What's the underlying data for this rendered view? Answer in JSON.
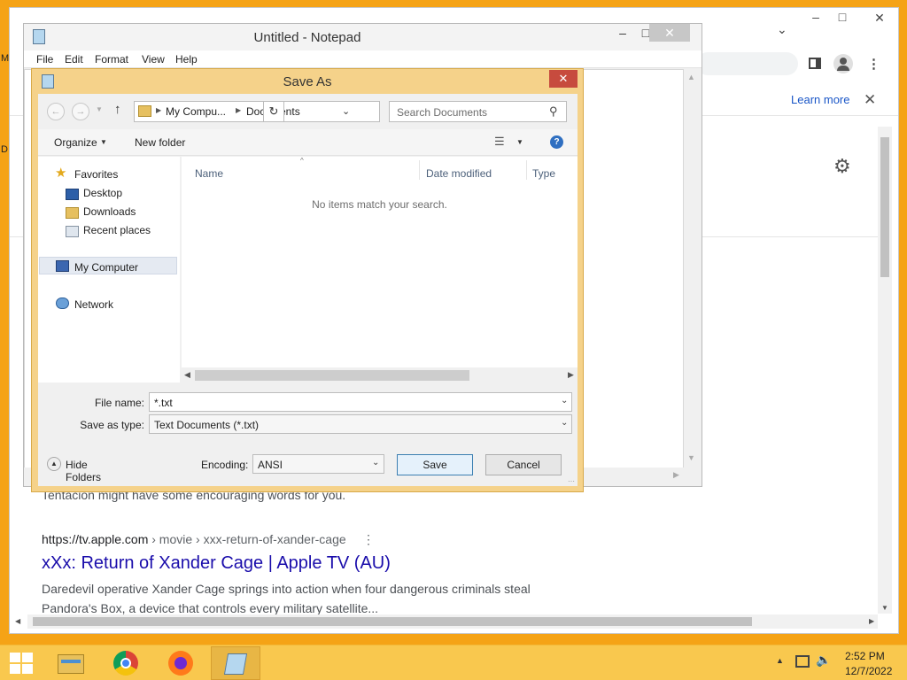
{
  "desktop": {
    "frag_m": "M",
    "frag_d": "D"
  },
  "chrome": {
    "minimize": "–",
    "maximize": "□",
    "close": "✕",
    "tab_dropdown": "⌄",
    "info_bar": {
      "learn_more": "Learn more",
      "close": "✕"
    },
    "results": {
      "fragment": "Tentación might have some encouraging words for you.",
      "url_host": "https://tv.apple.com",
      "url_path": " › movie › xxx-return-of-xander-cage",
      "title": "xXx: Return of Xander Cage | Apple TV (AU)",
      "desc_line1": "Daredevil operative Xander Cage springs into action when four dangerous criminals steal",
      "desc_line2": "Pandora's Box, a device that controls every military satellite..."
    }
  },
  "notepad": {
    "title": "Untitled - Notepad",
    "menu": [
      "File",
      "Edit",
      "Format",
      "View",
      "Help"
    ],
    "min": "–",
    "max": "□",
    "close": "✕"
  },
  "save_as": {
    "title": "Save As",
    "close": "✕",
    "breadcrumb": [
      "My Compu...",
      "Documents"
    ],
    "search_placeholder": "Search Documents",
    "toolbar": {
      "organize": "Organize",
      "new_folder": "New folder"
    },
    "nav": {
      "favorites": "Favorites",
      "desktop": "Desktop",
      "downloads": "Downloads",
      "recent": "Recent places",
      "my_computer": "My Computer",
      "network": "Network"
    },
    "columns": [
      "Name",
      "Date modified",
      "Type"
    ],
    "empty_message": "No items match your search.",
    "file_name_label": "File name:",
    "file_name_value": "*.txt",
    "save_type_label": "Save as type:",
    "save_type_value": "Text Documents (*.txt)",
    "hide_folders": "Hide Folders",
    "encoding_label": "Encoding:",
    "encoding_value": "ANSI",
    "save_button": "Save",
    "cancel_button": "Cancel"
  },
  "taskbar": {
    "apps": [
      "file-explorer",
      "chrome",
      "firefox",
      "notepad"
    ],
    "time": "2:52 PM",
    "date": "12/7/2022"
  },
  "colors": {
    "desktop": "#f5a316",
    "dialog_frame": "#f5d28a",
    "dialog_close": "#c74b3e",
    "link_blue": "#1a0dab",
    "taskbar": "#f9c84e"
  }
}
